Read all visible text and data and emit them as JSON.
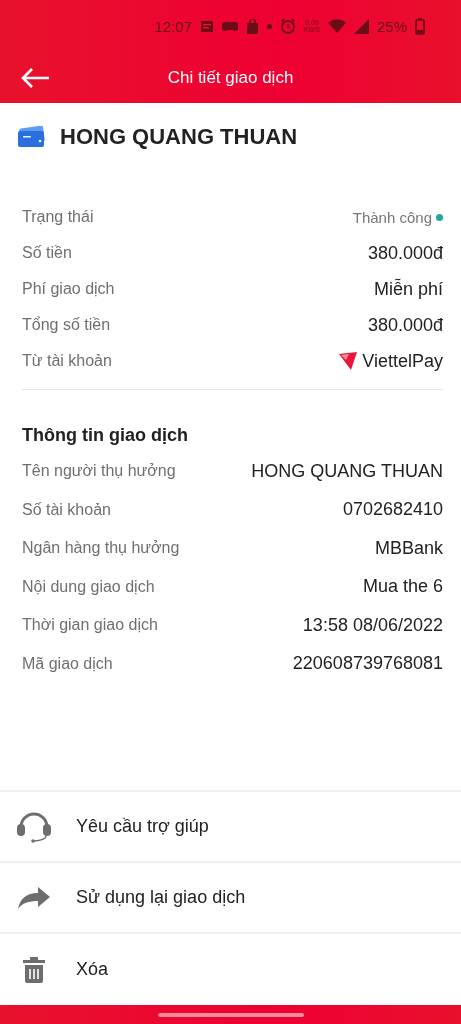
{
  "status_bar": {
    "time": "12:07",
    "net_speed": "0.05",
    "net_unit": "KB/S",
    "battery": "25%"
  },
  "header": {
    "title": "Chi tiết giao dịch"
  },
  "payee": {
    "name": "HONG QUANG THUAN"
  },
  "summary": [
    {
      "kind": "status",
      "label": "Trạng thái",
      "value": "Thành công",
      "color": "#26a69a"
    },
    {
      "kind": "text",
      "label": "Số tiền",
      "value": "380.000đ"
    },
    {
      "kind": "text",
      "label": "Phí giao dịch",
      "value": "Miễn phí"
    },
    {
      "kind": "text",
      "label": "Tổng số tiền",
      "value": "380.000đ"
    },
    {
      "kind": "wallet",
      "label": "Từ tài khoản",
      "value": "ViettelPay"
    }
  ],
  "details": {
    "title": "Thông tin giao dịch",
    "rows": [
      {
        "label": "Tên người thụ hưởng",
        "value": "HONG QUANG THUAN"
      },
      {
        "label": "Số tài khoản",
        "value": "0702682410"
      },
      {
        "label": "Ngân hàng thụ hưởng",
        "value": "MBBank"
      },
      {
        "label": "Nội dung giao dịch",
        "value": "Mua the 6"
      },
      {
        "label": "Thời gian giao dịch",
        "value": "13:58 08/06/2022"
      },
      {
        "label": "Mã giao dịch",
        "value": "220608739768081"
      }
    ]
  },
  "actions": [
    {
      "kind": "help",
      "label": "Yêu cầu trợ giúp"
    },
    {
      "kind": "reuse",
      "label": "Sử dụng lại giao dịch"
    },
    {
      "kind": "delete",
      "label": "Xóa"
    }
  ]
}
